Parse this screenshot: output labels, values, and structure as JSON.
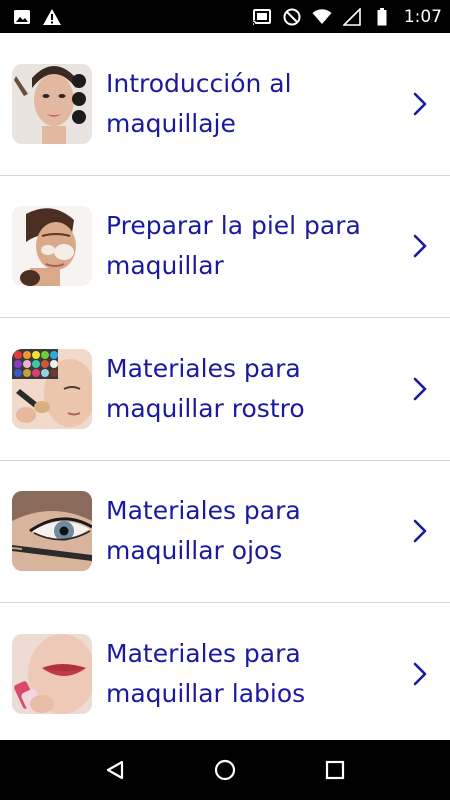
{
  "status_bar": {
    "time": "1:07",
    "left_icons": [
      "image-icon",
      "warning-icon"
    ],
    "right_icons": [
      "cast-icon",
      "do-not-disturb-icon",
      "wifi-icon",
      "signal-icon",
      "battery-icon"
    ]
  },
  "list": {
    "items": [
      {
        "label": "Introducción al\nmaquillaje",
        "thumb": "makeup-intro-thumbnail"
      },
      {
        "label": "Preparar la piel para\nmaquillar",
        "thumb": "skin-prep-thumbnail"
      },
      {
        "label": "Materiales para\nmaquillar rostro",
        "thumb": "face-materials-thumbnail"
      },
      {
        "label": "Materiales para\nmaquillar ojos",
        "thumb": "eye-materials-thumbnail"
      },
      {
        "label": "Materiales para\nmaquillar labios",
        "thumb": "lip-materials-thumbnail"
      }
    ]
  },
  "nav_bar": {
    "buttons": [
      "back-icon",
      "home-icon",
      "recents-icon"
    ]
  },
  "colors": {
    "label_text": "#1a1aa0",
    "chevron": "#1a1aa0",
    "divider": "#d6d6d6",
    "bars": "#000000"
  }
}
